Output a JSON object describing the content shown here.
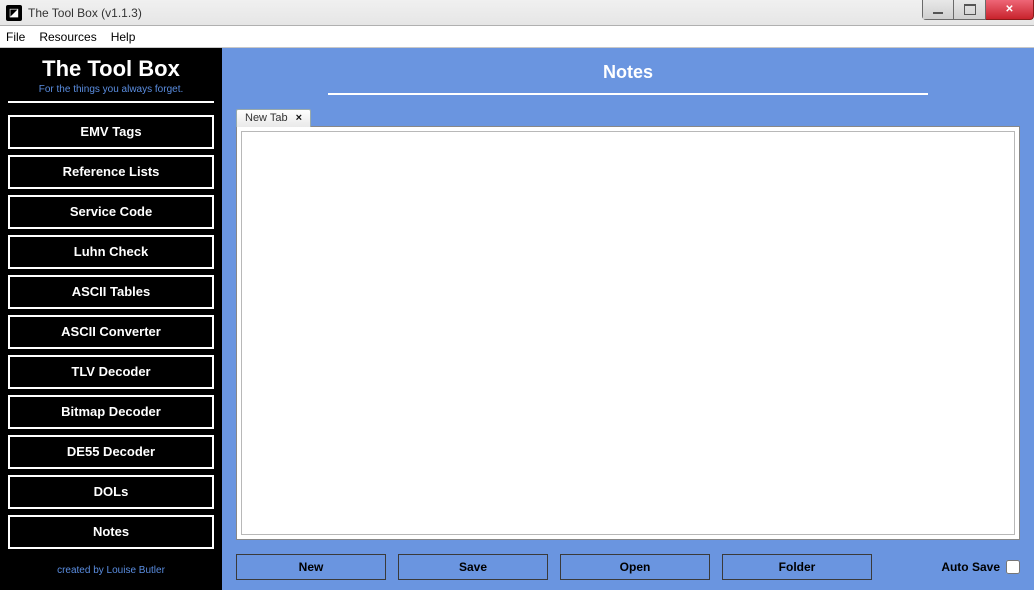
{
  "window": {
    "title": "The Tool Box (v1.1.3)"
  },
  "menu": {
    "items": [
      "File",
      "Resources",
      "Help"
    ]
  },
  "sidebar": {
    "title": "The Tool Box",
    "tagline": "For the things you always forget.",
    "items": [
      "EMV Tags",
      "Reference Lists",
      "Service Code",
      "Luhn Check",
      "ASCII Tables",
      "ASCII Converter",
      "TLV Decoder",
      "Bitmap Decoder",
      "DE55 Decoder",
      "DOLs",
      "Notes"
    ],
    "credit": "created by Louise Butler"
  },
  "content": {
    "title": "Notes",
    "tabs": [
      {
        "label": "New Tab",
        "close": "×"
      }
    ],
    "editor_value": "",
    "buttons": {
      "new": "New",
      "save": "Save",
      "open": "Open",
      "folder": "Folder"
    },
    "autosave_label": "Auto Save"
  }
}
